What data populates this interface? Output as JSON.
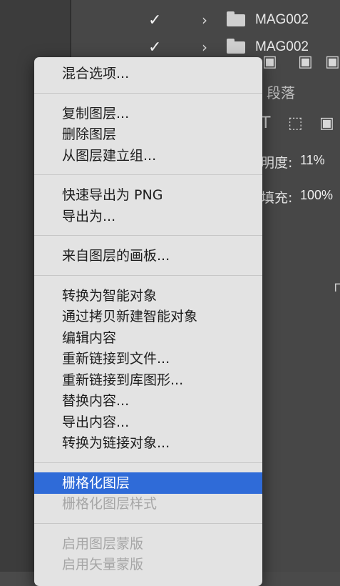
{
  "layers": [
    {
      "name": "MAG002"
    },
    {
      "name": "MAG002"
    }
  ],
  "panel": {
    "paragraph_tab": "段落",
    "opacity_label": "明度:",
    "opacity_value": "11%",
    "fill_label": "填充:",
    "fill_value": "100%"
  },
  "icons": {
    "check": "✓",
    "chevron": "›",
    "text_tool": "T",
    "transform": "⬚",
    "document": "▣",
    "lock": "⊓"
  },
  "menu": {
    "groups": [
      [
        {
          "label": "混合选项...",
          "enabled": true
        }
      ],
      [
        {
          "label": "复制图层...",
          "enabled": true
        },
        {
          "label": "删除图层",
          "enabled": true
        },
        {
          "label": "从图层建立组...",
          "enabled": true
        }
      ],
      [
        {
          "label": "快速导出为 PNG",
          "enabled": true
        },
        {
          "label": "导出为...",
          "enabled": true
        }
      ],
      [
        {
          "label": "来自图层的画板...",
          "enabled": true
        }
      ],
      [
        {
          "label": "转换为智能对象",
          "enabled": true
        },
        {
          "label": "通过拷贝新建智能对象",
          "enabled": true
        },
        {
          "label": "编辑内容",
          "enabled": true
        },
        {
          "label": "重新链接到文件...",
          "enabled": true
        },
        {
          "label": "重新链接到库图形...",
          "enabled": true
        },
        {
          "label": "替换内容...",
          "enabled": true
        },
        {
          "label": "导出内容...",
          "enabled": true
        },
        {
          "label": "转换为链接对象...",
          "enabled": true
        }
      ],
      [
        {
          "label": "栅格化图层",
          "enabled": true,
          "highlighted": true
        },
        {
          "label": "栅格化图层样式",
          "enabled": false
        }
      ],
      [
        {
          "label": "启用图层蒙版",
          "enabled": false
        },
        {
          "label": "启用矢量蒙版",
          "enabled": false
        }
      ]
    ]
  },
  "colors": {
    "highlight": "#2f6bd8",
    "menu_bg": "#e3e3e3",
    "panel_bg": "#474747"
  }
}
